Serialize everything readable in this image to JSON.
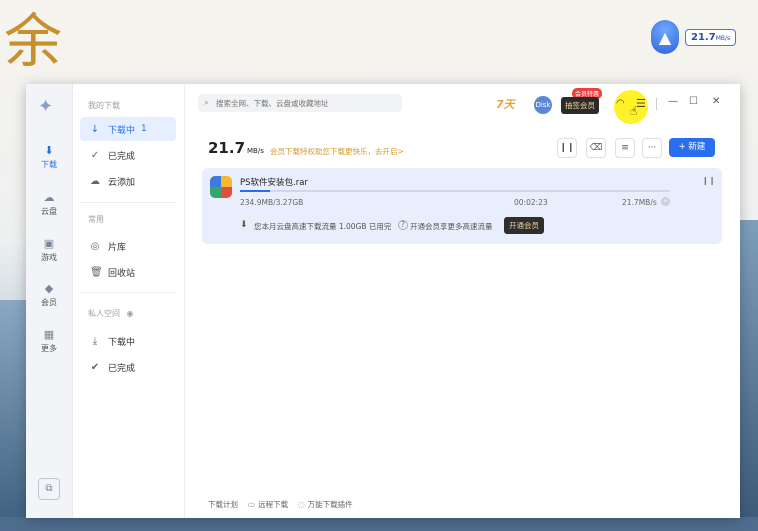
{
  "background": {
    "char": "余"
  },
  "speed_widget": {
    "value": "21.7",
    "unit": "MB/s"
  },
  "rail": {
    "items": [
      {
        "label": "下载",
        "icon": "download-circle-icon"
      },
      {
        "label": "云盘",
        "icon": "cloud-icon"
      },
      {
        "label": "游戏",
        "icon": "gamepad-icon"
      },
      {
        "label": "会员",
        "icon": "diamond-icon"
      },
      {
        "label": "更多",
        "icon": "grid-icon"
      }
    ]
  },
  "sidebar": {
    "section_my": "我的下载",
    "downloading": "下载中",
    "downloading_count": "1",
    "completed": "已完成",
    "cloud_add": "云添加",
    "section_common": "常用",
    "library": "片库",
    "recycle": "回收站",
    "section_private": "私人空间",
    "private_downloading": "下载中",
    "private_completed": "已完成"
  },
  "header": {
    "search_placeholder": "搜索全网、下载、云盘或收藏地址",
    "badge": "7天",
    "avatar": "Disk",
    "vip_tag": "会员特惠",
    "vip_button": "抽签会员"
  },
  "toolbar": {
    "speed": "21.7",
    "speed_unit": "MB/s",
    "promo": "会员下载特权助您下载更快乐，去开启>",
    "new_button": "新建"
  },
  "task": {
    "name": "PS软件安装包.rar",
    "size": "234.9MB/3.27GB",
    "time": "00:02:23",
    "speed": "21.7MB/s",
    "progress": 0.07,
    "notice": "您本月云盘高速下载流量 1.00GB 已用完",
    "notice2": "开通会员享更多高速流量",
    "open_vip": "开通会员"
  },
  "footer": {
    "plan": "下载计划",
    "remote": "远程下载",
    "plugin": "万能下载插件"
  },
  "colors": {
    "accent": "#2a6ef0",
    "promo": "#d49a2a"
  }
}
